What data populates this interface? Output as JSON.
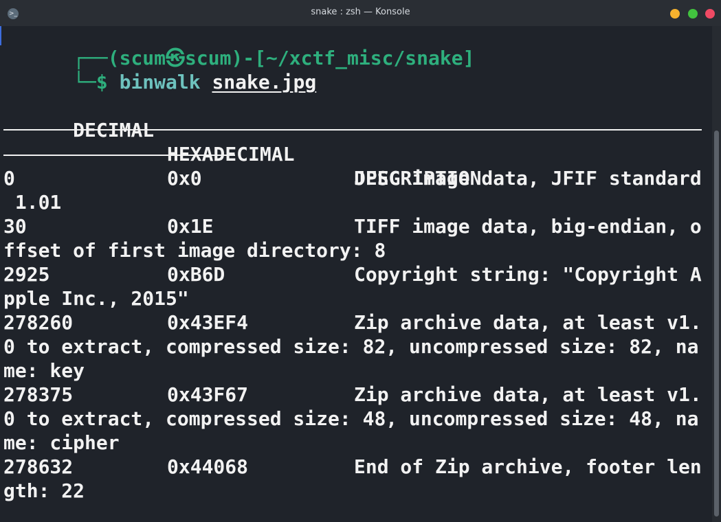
{
  "window": {
    "title": "snake : zsh — Konsole"
  },
  "terminal": {
    "prompt_user": "┌──(scum㉿scum)-[~/xctf_misc/snake]",
    "prompt_symbol": "└─$",
    "command": "binwalk",
    "argument": "snake.jpg",
    "header_decimal": "DECIMAL",
    "header_hex": "HEXADECIMAL",
    "header_desc": "DESCRIPTION",
    "rows": [
      [
        "0",
        "0x0",
        "JPEG image data, JFIF standard",
        " 1.01"
      ],
      [
        "30",
        "0x1E",
        "TIFF image data, big-endian, o",
        "ffset of first image directory: 8"
      ],
      [
        "2925",
        "0xB6D",
        "Copyright string: \"Copyright A",
        "pple Inc., 2015\""
      ],
      [
        "278260",
        "0x43EF4",
        "Zip archive data, at least v1.",
        "0 to extract, compressed size: 82, uncompressed size: 82, na",
        "me: key"
      ],
      [
        "278375",
        "0x43F67",
        "Zip archive data, at least v1.",
        "0 to extract, compressed size: 48, uncompressed size: 48, na",
        "me: cipher"
      ],
      [
        "278632",
        "0x44068",
        "End of Zip archive, footer len",
        "gth: 22"
      ]
    ]
  },
  "colors": {
    "background": "#1f232a",
    "prompt_green": "#2eaf7d",
    "prompt_blue": "#4f8df6",
    "command": "#6ec2be"
  }
}
